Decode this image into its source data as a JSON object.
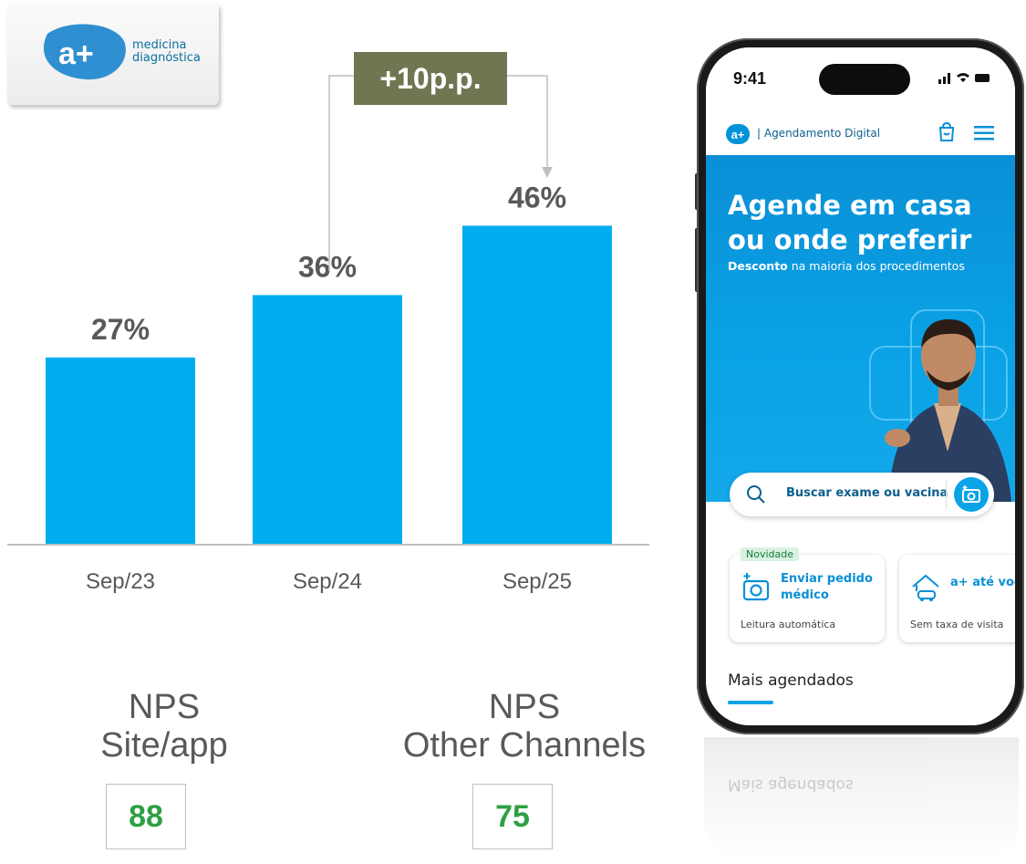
{
  "logo": {
    "line1": "medicina",
    "line2": "diagnóstica",
    "mark": "a+"
  },
  "delta": {
    "label": "+10p.p."
  },
  "chart_data": {
    "type": "bar",
    "categories": [
      "Sep/23",
      "Sep/24",
      "Sep/25"
    ],
    "values": [
      27,
      36,
      46
    ],
    "value_labels": [
      "27%",
      "36%",
      "46%"
    ],
    "ylim": [
      0,
      50
    ],
    "bar_color": "#00adef",
    "grid": false,
    "title": "",
    "xlabel": "",
    "ylabel": ""
  },
  "nps": [
    {
      "title_line1": "NPS",
      "title_line2": "Site/app",
      "value": "88"
    },
    {
      "title_line1": "NPS",
      "title_line2": "Other Channels",
      "value": "75"
    }
  ],
  "phone": {
    "time": "9:41",
    "app_logo": "a+",
    "app_title": "| Agendamento Digital",
    "hero_line1": "Agende em casa",
    "hero_line2": "ou onde preferir",
    "hero_sub_bold": "Desconto",
    "hero_sub_rest": " na maioria dos procedimentos",
    "search_placeholder": "Buscar exame ou vacina",
    "card1": {
      "badge": "Novidade",
      "title_line1": "Enviar pedido",
      "title_line2": "médico",
      "subtitle": "Leitura automática"
    },
    "card2": {
      "title": "a+ até você",
      "subtitle": "Sem taxa de visita"
    },
    "section_title": "Mais agendados"
  },
  "colors": {
    "bar": "#00adef",
    "delta_box": "#6f7651",
    "nps_value": "#2ea043",
    "brand": "#0093d9"
  }
}
